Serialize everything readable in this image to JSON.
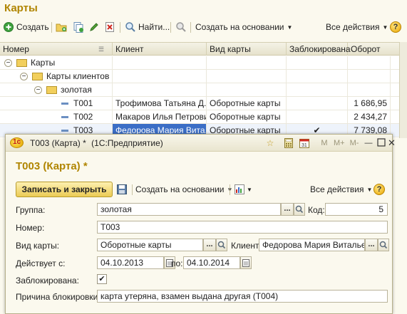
{
  "main": {
    "title": "Карты",
    "toolbar": {
      "create": "Создать",
      "find": "Найти...",
      "create_based_on": "Создать на основании",
      "all_actions": "Все действия",
      "help": "?"
    },
    "columns": [
      "Номер",
      "Клиент",
      "Вид карты",
      "Заблокирована",
      "Оборот"
    ],
    "tree": [
      {
        "level": 0,
        "label": "Карты"
      },
      {
        "level": 1,
        "label": "Карты клиентов"
      },
      {
        "level": 2,
        "label": "золотая"
      }
    ],
    "rows": [
      {
        "number": "Т001",
        "client": "Трофимова Татьяна Д...",
        "card_type": "Оборотные карты",
        "blocked": "",
        "turnover": "1 686,95"
      },
      {
        "number": "Т002",
        "client": "Макаров Илья Петрович",
        "card_type": "Оборотные карты",
        "blocked": "",
        "turnover": "2 434,27"
      },
      {
        "number": "Т003",
        "client": "Федорова Мария Вита...",
        "card_type": "Оборотные карты",
        "blocked": "✔",
        "turnover": "7 739,08"
      }
    ]
  },
  "dialog": {
    "window_title": "Т003 (Карта) *",
    "app_name": "(1С:Предприятие)",
    "heading": "Т003 (Карта) *",
    "title_buttons": [
      "M",
      "M+",
      "M-"
    ],
    "save_close": "Записать и закрыть",
    "create_based_on": "Создать на основании",
    "all_actions": "Все действия",
    "help": "?",
    "fields": {
      "group_label": "Группа:",
      "group_value": "золотая",
      "code_label": "Код:",
      "code_value": "5",
      "number_label": "Номер:",
      "number_value": "Т003",
      "card_type_label": "Вид карты:",
      "card_type_value": "Оборотные карты",
      "client_label": "Клиент:",
      "client_value": "Федорова Мария Витальевн",
      "valid_from_label": "Действует с:",
      "valid_from_value": "04.10.2013",
      "valid_to_label": "по:",
      "valid_to_value": "04.10.2014",
      "blocked_label": "Заблокирована:",
      "blocked_checked": true,
      "reason_label": "Причина блокировки:",
      "reason_value": "карта утеряна, взамен выдана другая (Т004)"
    }
  },
  "colors": {
    "accent_title": "#b08500",
    "selected_row": "#3b6ec6",
    "yellow_button": "#ebcb55"
  }
}
